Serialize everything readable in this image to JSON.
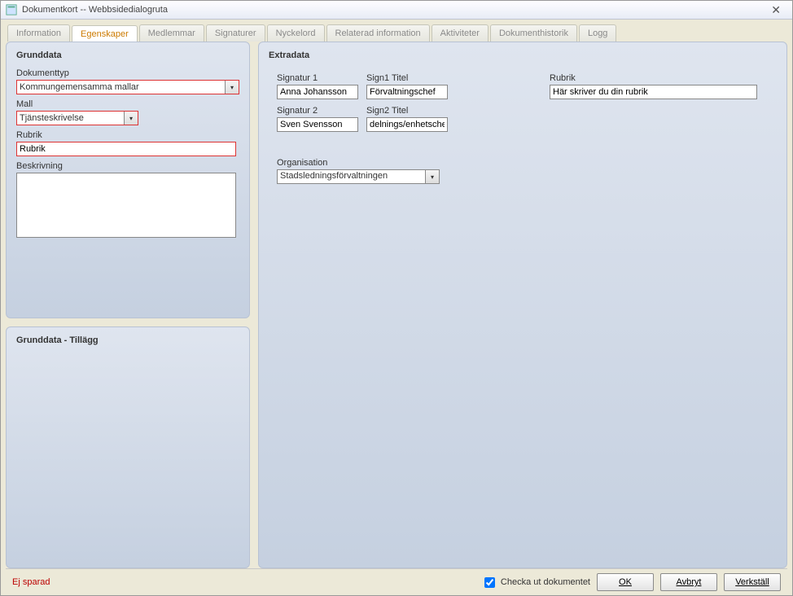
{
  "title": "Dokumentkort -- Webbsidedialogruta",
  "tabs": [
    "Information",
    "Egenskaper",
    "Medlemmar",
    "Signaturer",
    "Nyckelord",
    "Relaterad information",
    "Aktiviteter",
    "Dokumenthistorik",
    "Logg"
  ],
  "active_tab": "Egenskaper",
  "grunddata": {
    "title": "Grunddata",
    "dokumenttyp_label": "Dokumenttyp",
    "dokumenttyp_value": "Kommungemensamma mallar",
    "mall_label": "Mall",
    "mall_value": "Tjänsteskrivelse",
    "rubrik_label": "Rubrik",
    "rubrik_value": "Rubrik",
    "beskrivning_label": "Beskrivning",
    "beskrivning_value": ""
  },
  "grunddata_tillagg": {
    "title": "Grunddata - Tillägg"
  },
  "extradata": {
    "title": "Extradata",
    "sig1_label": "Signatur 1",
    "sig1_value": "Anna Johansson",
    "sig1titel_label": "Sign1 Titel",
    "sig1titel_value": "Förvaltningschef",
    "sig2_label": "Signatur 2",
    "sig2_value": "Sven Svensson",
    "sig2titel_label": "Sign2 Titel",
    "sig2titel_value": "delnings/enhetschef",
    "rubrik_label": "Rubrik",
    "rubrik_value": "Här skriver du din rubrik",
    "org_label": "Organisation",
    "org_value": "Stadsledningsförvaltningen"
  },
  "footer": {
    "status": "Ej sparad",
    "check_label": "Checka ut dokumentet",
    "checked": true,
    "ok": "OK",
    "cancel": "Avbryt",
    "apply": "Verkställ"
  }
}
